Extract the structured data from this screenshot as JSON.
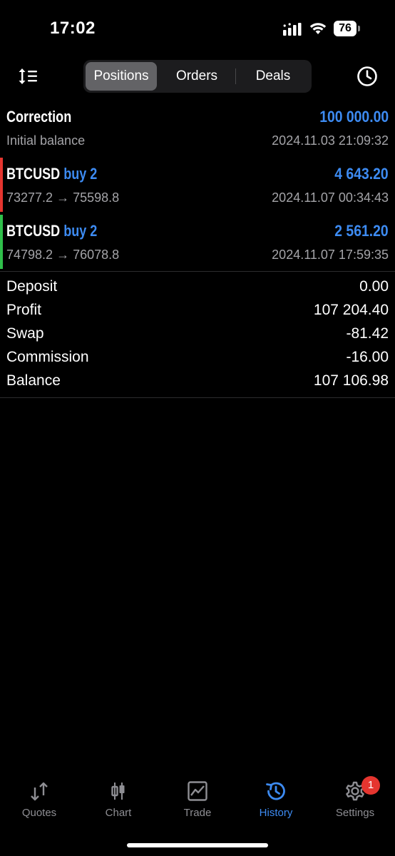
{
  "status_bar": {
    "time": "17:02",
    "battery": "76",
    "icons": [
      "signal-icon",
      "wifi-icon",
      "battery-icon"
    ]
  },
  "toolbar": {
    "left_icon": "sort-icon",
    "right_icon": "clock-icon",
    "tabs": [
      {
        "label": "Positions",
        "selected": true
      },
      {
        "label": "Orders",
        "selected": false
      },
      {
        "label": "Deals",
        "selected": false
      }
    ]
  },
  "rows": [
    {
      "symbol": "Correction",
      "type": "",
      "amount": "100 000.00",
      "detail": "Initial balance",
      "time": "2024.11.03 21:09:32",
      "bar_color": ""
    },
    {
      "symbol": "BTCUSD",
      "type": "buy 2",
      "amount": "4 643.20",
      "detail": "73277.2 → 75598.8",
      "time": "2024.11.07 00:34:43",
      "bar_color": "#e5352f"
    },
    {
      "symbol": "BTCUSD",
      "type": "buy 2",
      "amount": "2 561.20",
      "detail": "74798.2 → 76078.8",
      "time": "2024.11.07 17:59:35",
      "bar_color": "#2fbf4a"
    }
  ],
  "summary": [
    {
      "label": "Deposit",
      "value": "0.00"
    },
    {
      "label": "Profit",
      "value": "107 204.40"
    },
    {
      "label": "Swap",
      "value": "-81.42"
    },
    {
      "label": "Commission",
      "value": "-16.00"
    },
    {
      "label": "Balance",
      "value": "107 106.98"
    }
  ],
  "tab_bar": [
    {
      "label": "Quotes",
      "icon": "quotes-icon",
      "active": false
    },
    {
      "label": "Chart",
      "icon": "chart-icon",
      "active": false
    },
    {
      "label": "Trade",
      "icon": "trade-icon",
      "active": false
    },
    {
      "label": "History",
      "icon": "history-icon",
      "active": true
    },
    {
      "label": "Settings",
      "icon": "gear-icon",
      "active": false,
      "badge": "1"
    }
  ],
  "colors": {
    "accent": "#3d8bf2",
    "loss_bar": "#e5352f",
    "profit_bar": "#2fbf4a",
    "badge": "#e5352f"
  }
}
